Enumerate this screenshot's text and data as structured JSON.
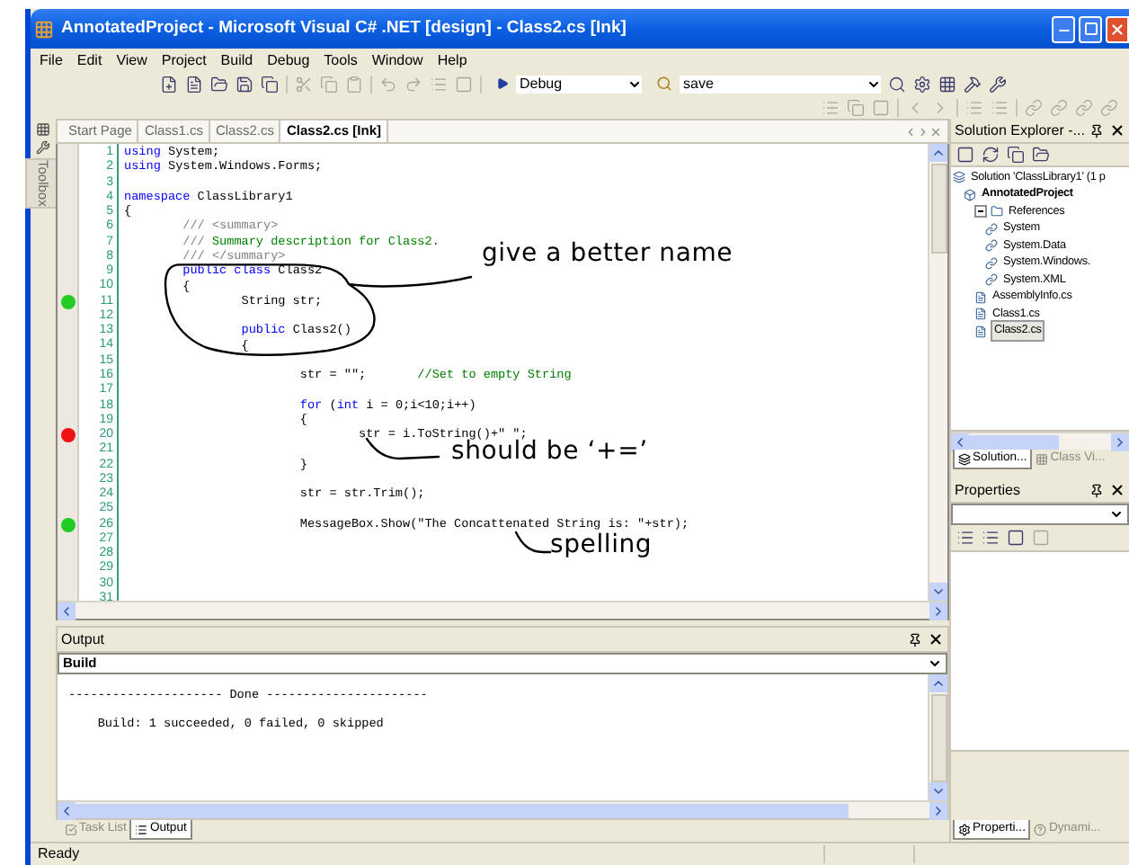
{
  "window": {
    "title": "AnnotatedProject - Microsoft Visual C# .NET [design] - Class2.cs [Ink]"
  },
  "menu": [
    "File",
    "Edit",
    "View",
    "Project",
    "Build",
    "Debug",
    "Tools",
    "Window",
    "Help"
  ],
  "toolbar": {
    "configuration": "Debug",
    "find": "save"
  },
  "toolbox": {
    "label": "Toolbox"
  },
  "tabs": [
    {
      "label": "Start Page",
      "selected": false
    },
    {
      "label": "Class1.cs",
      "selected": false
    },
    {
      "label": "Class2.cs",
      "selected": false
    },
    {
      "label": "Class2.cs [Ink]",
      "selected": true
    }
  ],
  "editor": {
    "lines": [
      {
        "number": "1",
        "tokens": [
          {
            "kind": "keyword",
            "text": "using"
          },
          {
            "kind": "plain",
            "text": " System;"
          }
        ]
      },
      {
        "number": "2",
        "tokens": [
          {
            "kind": "keyword",
            "text": "using"
          },
          {
            "kind": "plain",
            "text": " System.Windows.Forms;"
          }
        ]
      },
      {
        "number": "3"
      },
      {
        "number": "4",
        "tokens": [
          {
            "kind": "keyword",
            "text": "namespace"
          },
          {
            "kind": "plain",
            "text": " ClassLibrary1"
          }
        ]
      },
      {
        "number": "5",
        "tokens": [
          {
            "kind": "plain",
            "text": "{"
          }
        ]
      },
      {
        "number": "6",
        "tokens": [
          {
            "kind": "doc",
            "text": "        /// <summary>"
          }
        ]
      },
      {
        "number": "7",
        "tokens": [
          {
            "kind": "doc",
            "text": "        ///"
          },
          {
            "kind": "comment",
            "text": " Summary description for Class2."
          }
        ]
      },
      {
        "number": "8",
        "tokens": [
          {
            "kind": "doc",
            "text": "        /// </summary>"
          }
        ]
      },
      {
        "number": "9",
        "tokens": [
          {
            "kind": "keyword",
            "text": "        public class"
          },
          {
            "kind": "plain",
            "text": " Class2"
          }
        ]
      },
      {
        "number": "10",
        "tokens": [
          {
            "kind": "plain",
            "text": "        {"
          }
        ]
      },
      {
        "number": "11",
        "color": "#22cc22",
        "tokens": [
          {
            "kind": "plain",
            "text": "                String str;"
          }
        ]
      },
      {
        "number": "12"
      },
      {
        "number": "13",
        "tokens": [
          {
            "kind": "keyword",
            "text": "                public"
          },
          {
            "kind": "plain",
            "text": " Class2()"
          }
        ]
      },
      {
        "number": "14",
        "tokens": [
          {
            "kind": "plain",
            "text": "                {"
          }
        ]
      },
      {
        "number": "15"
      },
      {
        "number": "16",
        "tokens": [
          {
            "kind": "plain",
            "text": "                        str = \"\";      "
          },
          {
            "kind": "comment",
            "text": " //Set to empty String"
          }
        ]
      },
      {
        "number": "17"
      },
      {
        "number": "18",
        "tokens": [
          {
            "kind": "keyword",
            "text": "                        for"
          },
          {
            "kind": "plain",
            "text": " ("
          },
          {
            "kind": "keyword",
            "text": "int"
          },
          {
            "kind": "plain",
            "text": " i = 0;i<10;i++)"
          }
        ]
      },
      {
        "number": "19",
        "tokens": [
          {
            "kind": "plain",
            "text": "                        {"
          }
        ]
      },
      {
        "number": "20",
        "color": "#ee1111",
        "tokens": [
          {
            "kind": "plain",
            "text": "                                str = i.ToString()+\" \";"
          }
        ]
      },
      {
        "number": "21"
      },
      {
        "number": "22",
        "tokens": [
          {
            "kind": "plain",
            "text": "                        }"
          }
        ]
      },
      {
        "number": "23"
      },
      {
        "number": "24",
        "tokens": [
          {
            "kind": "plain",
            "text": "                        str = str.Trim();"
          }
        ]
      },
      {
        "number": "25"
      },
      {
        "number": "26",
        "color": "#22cc22",
        "tokens": [
          {
            "kind": "plain",
            "text": "                        MessageBox.Show(\"The Concattenated String is: \"+str);"
          }
        ]
      },
      {
        "number": "27"
      },
      {
        "number": "28"
      },
      {
        "number": "29"
      },
      {
        "number": "30"
      },
      {
        "number": "31"
      }
    ],
    "annotations": [
      {
        "text": "give a better name"
      },
      {
        "text": "should be ‘+=’"
      },
      {
        "text": "spelling"
      }
    ]
  },
  "solution_explorer": {
    "title": "Solution Explorer -...",
    "tree": [
      {
        "kind": "solution",
        "label": "Solution 'ClassLibrary1' (1 p",
        "selected": false,
        "children": [
          {
            "kind": "project",
            "label": "AnnotatedProject",
            "selected": false,
            "children": [
              {
                "kind": "folder",
                "label": "References",
                "selected": false,
                "expanded": true,
                "children": [
                  {
                    "kind": "reference",
                    "label": "System",
                    "selected": false
                  },
                  {
                    "kind": "reference",
                    "label": "System.Data",
                    "selected": false
                  },
                  {
                    "kind": "reference",
                    "label": "System.Windows.",
                    "selected": false
                  },
                  {
                    "kind": "reference",
                    "label": "System.XML",
                    "selected": false
                  }
                ]
              },
              {
                "kind": "file",
                "label": "AssemblyInfo.cs",
                "selected": false
              },
              {
                "kind": "file",
                "label": "Class1.cs",
                "selected": false
              },
              {
                "kind": "file",
                "label": "Class2.cs",
                "selected": true
              }
            ]
          }
        ]
      }
    ],
    "tabs": [
      {
        "label": "Solution...",
        "selected": true
      },
      {
        "label": "Class Vi...",
        "selected": false
      }
    ]
  },
  "properties": {
    "title": "Properties"
  },
  "right_tabs": [
    {
      "label": "Properti...",
      "selected": true
    },
    {
      "label": "Dynami...",
      "selected": false
    }
  ],
  "output": {
    "title": "Output",
    "source": "Build",
    "lines": [
      "--------------------- Done ----------------------",
      "    Build: 1 succeeded, 0 failed, 0 skipped"
    ],
    "tabs": [
      {
        "label": "Task List",
        "selected": false
      },
      {
        "label": "Output",
        "selected": true
      }
    ]
  },
  "status_bar": {
    "text": "Ready"
  }
}
